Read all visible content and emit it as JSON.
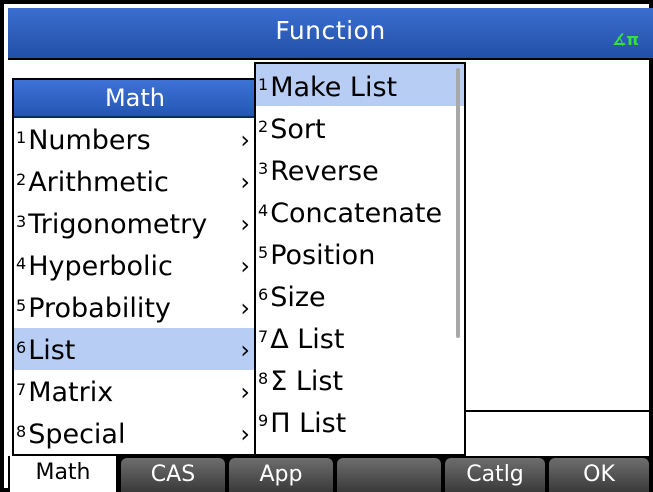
{
  "title": "Function",
  "angle_indicator": "∡π",
  "math_menu": {
    "header": "Math",
    "items": [
      {
        "num": "1",
        "label": "Numbers",
        "submenu": "›"
      },
      {
        "num": "2",
        "label": "Arithmetic",
        "submenu": "›"
      },
      {
        "num": "3",
        "label": "Trigonometry",
        "submenu": "›"
      },
      {
        "num": "4",
        "label": "Hyperbolic",
        "submenu": "›"
      },
      {
        "num": "5",
        "label": "Probability",
        "submenu": "›"
      },
      {
        "num": "6",
        "label": "List",
        "submenu": "›"
      },
      {
        "num": "7",
        "label": "Matrix",
        "submenu": "›"
      },
      {
        "num": "8",
        "label": "Special",
        "submenu": "›"
      }
    ]
  },
  "list_menu": {
    "items": [
      {
        "num": "1",
        "label": "Make List"
      },
      {
        "num": "2",
        "label": "Sort"
      },
      {
        "num": "3",
        "label": "Reverse"
      },
      {
        "num": "4",
        "label": "Concatenate"
      },
      {
        "num": "5",
        "label": "Position"
      },
      {
        "num": "6",
        "label": "Size"
      },
      {
        "num": "7",
        "label": "Δ List"
      },
      {
        "num": "8",
        "label": "Σ List"
      },
      {
        "num": "9",
        "label": "Π List"
      }
    ]
  },
  "softkeys": [
    "Math",
    "CAS",
    "App",
    "",
    "Catlg",
    "OK"
  ]
}
